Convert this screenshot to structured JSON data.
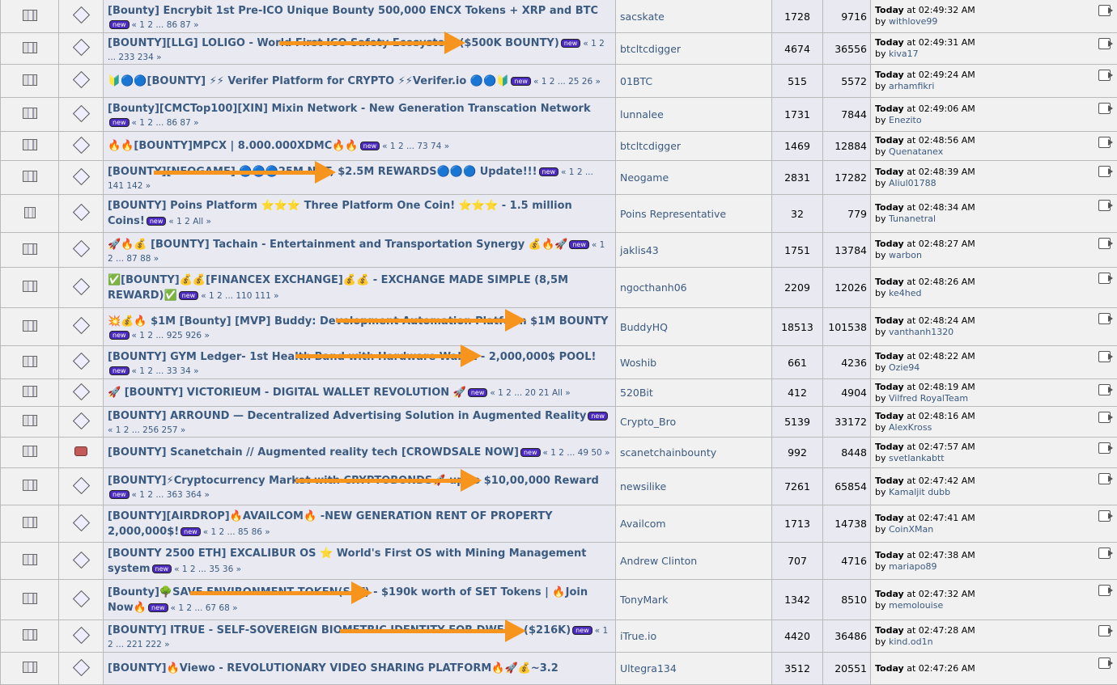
{
  "labels": {
    "new": "new",
    "today": "Today",
    "at": "at",
    "by": "by"
  },
  "colors": {
    "link": "#3b5a80",
    "arrow": "#f7941d",
    "new_badge": "#4b2bbf"
  },
  "rows": [
    {
      "icon": "topic",
      "msg": "page",
      "title": "[Bounty] Encrybit 1st Pre-ICO Unique Bounty  500,000 ENCX Tokens + XRP and BTC",
      "pages": "« 1 2 ... 86 87 »",
      "starter": "sacskate",
      "replies": "1728",
      "views": "9716",
      "time": "02:49:32 AM",
      "by": "withlove99"
    },
    {
      "icon": "topic",
      "msg": "page",
      "title": "[BOUNTY][LLG] LOLIGO - World First ICO Safety Ecosystem ($500K BOUNTY)",
      "pages": "« 1 2 ... 233 234 »",
      "starter": "btcltcdigger",
      "replies": "4674",
      "views": "36556",
      "time": "02:49:31 AM",
      "by": "kiva17"
    },
    {
      "icon": "topic",
      "msg": "page",
      "title": "🔰🔵🔵[BOUNTY] ⚡⚡ Verifer Platform for CRYPTO ⚡⚡Verifer.io 🔵🔵🔰",
      "pages": "« 1 2 ... 25 26 »",
      "starter": "01BTC",
      "replies": "515",
      "views": "5572",
      "time": "02:49:24 AM",
      "by": "arhamfikri"
    },
    {
      "icon": "topic",
      "msg": "page",
      "title": "[Bounty][CMCTop100][XIN] Mixin Network - New Generation Transcation Network",
      "pages": "« 1 2 ... 86 87 »",
      "starter": "lunnalee",
      "replies": "1731",
      "views": "7844",
      "time": "02:49:06 AM",
      "by": "Enezito"
    },
    {
      "icon": "topic",
      "msg": "page",
      "title": "🔥🔥[BOUNTY]MPCX | 8.000.000XDMC🔥🔥",
      "pages": "« 1 2 ... 73 74 »",
      "starter": "btcltcdigger",
      "replies": "1469",
      "views": "12884",
      "time": "02:48:56 AM",
      "by": "Quenatanex"
    },
    {
      "icon": "topic",
      "msg": "page",
      "title": "[BOUNTY][NEOGAME] 🔵🔵🔵25M NGT, $2.5M REWARDS🔵🔵🔵 Update!!!",
      "pages": "« 1 2 ... 141 142 »",
      "starter": "Neogame",
      "replies": "2831",
      "views": "17282",
      "time": "02:48:39 AM",
      "by": "Aliul01788"
    },
    {
      "icon": "topic-small",
      "msg": "page",
      "title": "[BOUNTY] Poins Platform ⭐⭐⭐ Three Platform One Coin! ⭐⭐⭐ - 1.5 million Coins!",
      "pages": "« 1 2  All »",
      "starter": "Poins Representative",
      "replies": "32",
      "views": "779",
      "time": "02:48:34 AM",
      "by": "Tunanetral"
    },
    {
      "icon": "topic",
      "msg": "page",
      "title": "🚀🔥💰 [BOUNTY] Tachain - Entertainment and Transportation Synergy 💰🔥🚀",
      "pages": "« 1 2 ... 87 88 »",
      "starter": "jaklis43",
      "replies": "1751",
      "views": "13784",
      "time": "02:48:27 AM",
      "by": "warbon"
    },
    {
      "icon": "topic",
      "msg": "page",
      "title": "✅[BOUNTY]💰💰[FINANCEX EXCHANGE]💰💰 - EXCHANGE MADE SIMPLE (8,5M REWARD)✅",
      "pages": "« 1 2 ... 110 111 »",
      "starter": "ngocthanh06",
      "replies": "2209",
      "views": "12026",
      "time": "02:48:26 AM",
      "by": "ke4hed"
    },
    {
      "icon": "topic",
      "msg": "page",
      "title": "💥💰🔥 $1M [Bounty] [MVP] Buddy: Development Automation Platform $1M BOUNTY",
      "pages": "« 1 2 ... 925 926 »",
      "starter": "BuddyHQ",
      "replies": "18513",
      "views": "101538",
      "time": "02:48:24 AM",
      "by": "vanthanh1320"
    },
    {
      "icon": "topic",
      "msg": "page",
      "title": "[BOUNTY] GYM Ledger- 1st Health Band with Hardware Wallet - 2,000,000$ POOL!",
      "pages": "« 1 2 ... 33 34 »",
      "starter": "Woshib",
      "replies": "661",
      "views": "4236",
      "time": "02:48:22 AM",
      "by": "Ozie94"
    },
    {
      "icon": "topic",
      "msg": "page",
      "title": "🚀 [BOUNTY] VICTORIEUM - DIGITAL WALLET REVOLUTION 🚀",
      "pages": "« 1 2 ... 20 21  All »",
      "starter": "520Bit",
      "replies": "412",
      "views": "4904",
      "time": "02:48:19 AM",
      "by": "Vilfred RoyalTeam"
    },
    {
      "icon": "topic",
      "msg": "page",
      "title": "[BOUNTY] ARROUND — Decentralized Advertising Solution in Augmented Reality",
      "pages": "« 1 2 ... 256 257 »",
      "starter": "Crypto_Bro",
      "replies": "5139",
      "views": "33172",
      "time": "02:48:16 AM",
      "by": "AlexKross"
    },
    {
      "icon": "topic",
      "msg": "thumb",
      "title": "[BOUNTY] Scanetchain // Augmented reality tech [CROWDSALE NOW]",
      "pages": "« 1 2 ... 49 50 »",
      "starter": "scanetchainbounty",
      "replies": "992",
      "views": "8448",
      "time": "02:47:57 AM",
      "by": "svetlankabtt"
    },
    {
      "icon": "topic",
      "msg": "page",
      "title": "[BOUNTY]⚡Cryptocurrency Market with CRYPTOBONDS🚀 up to $10,00,000 Reward",
      "pages": "« 1 2 ... 363 364 »",
      "starter": "newsilike",
      "replies": "7261",
      "views": "65854",
      "time": "02:47:42 AM",
      "by": "Kamaljit dubb"
    },
    {
      "icon": "topic",
      "msg": "page",
      "title": "[BOUNTY][AIRDROP]🔥AVAILCOM🔥 -NEW GENERATION RENT OF PROPERTY 2,000,000$!",
      "pages": "« 1 2 ... 85 86 »",
      "starter": "Availcom",
      "replies": "1713",
      "views": "14738",
      "time": "02:47:41 AM",
      "by": "CoinXMan"
    },
    {
      "icon": "topic",
      "msg": "page",
      "title": "[BOUNTY 2500 ETH] EXCALIBUR OS ⭐ World's First OS with Mining Management system",
      "pages": "« 1 2 ... 35 36 »",
      "starter": "Andrew Clinton",
      "replies": "707",
      "views": "4716",
      "time": "02:47:38 AM",
      "by": "mariapo89"
    },
    {
      "icon": "topic",
      "msg": "page",
      "title": "[Bounty]🌳SAVE ENVIRONMENT TOKEN(SET) - $190k worth of SET Tokens | 🔥Join Now🔥",
      "pages": "« 1 2 ... 67 68 »",
      "starter": "TonyMark",
      "replies": "1342",
      "views": "8510",
      "time": "02:47:32 AM",
      "by": "memolouise"
    },
    {
      "icon": "topic",
      "msg": "page",
      "title": "[BOUNTY] ITRUE - SELF-SOVEREIGN BIOMETRIC IDENTITY FOR DWEB - ($216K)",
      "pages": "« 1 2 ... 221 222 »",
      "starter": "iTrue.io",
      "replies": "4420",
      "views": "36486",
      "time": "02:47:28 AM",
      "by": "kind.od1n"
    },
    {
      "icon": "topic",
      "msg": "page",
      "title": "[BOUNTY]🔥Viewo - REVOLUTIONARY VIDEO SHARING PLATFORM🔥🚀💰~3.2",
      "pages": "",
      "starter": "Ultegra134",
      "replies": "3512",
      "views": "20551",
      "time": "02:47:26 AM",
      "by": ""
    }
  ]
}
